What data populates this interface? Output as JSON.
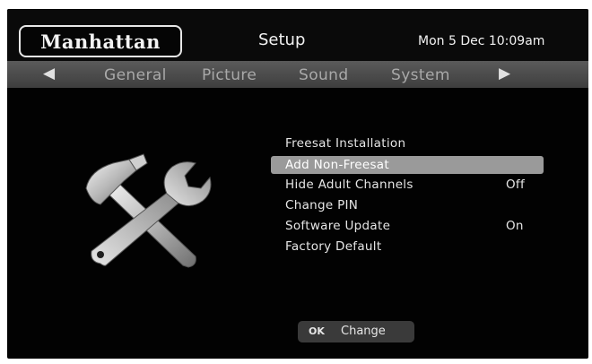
{
  "header": {
    "logo_text": "Manhattan",
    "title": "Setup",
    "datetime": "Mon 5 Dec 10:09am"
  },
  "tabs": {
    "prev_icon": "triangle-left-icon",
    "next_icon": "triangle-right-icon",
    "items": [
      {
        "label": "General"
      },
      {
        "label": "Picture"
      },
      {
        "label": "Sound"
      },
      {
        "label": "System"
      }
    ]
  },
  "menu": {
    "items": [
      {
        "label": "Freesat Installation",
        "value": ""
      },
      {
        "label": "Add Non-Freesat",
        "value": "",
        "selected": true
      },
      {
        "label": "Hide Adult Channels",
        "value": "Off"
      },
      {
        "label": "Change PIN",
        "value": ""
      },
      {
        "label": "Software Update",
        "value": "On"
      },
      {
        "label": "Factory Default",
        "value": ""
      }
    ]
  },
  "footer": {
    "ok_key": "OK",
    "ok_label": "Change"
  },
  "illustration": {
    "icon": "tools-icon"
  }
}
